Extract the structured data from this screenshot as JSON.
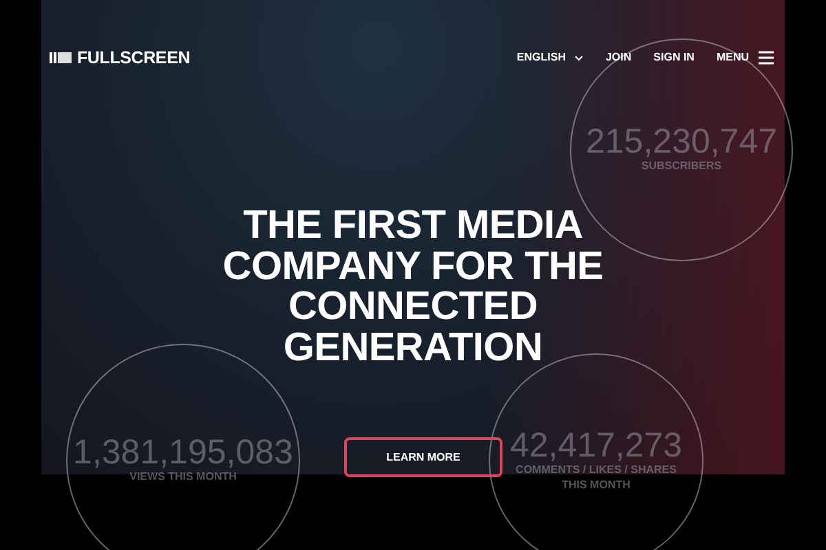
{
  "header": {
    "logo": "FULLSCREEN",
    "nav": [
      {
        "label": "ENGLISH",
        "kind": "dropdown"
      },
      {
        "label": "JOIN",
        "kind": "link"
      },
      {
        "label": "SIGN IN",
        "kind": "link"
      },
      {
        "label": "MENU",
        "kind": "menu"
      }
    ]
  },
  "hero": {
    "headline": "THE FIRST MEDIA COMPANY FOR THE CONNECTED GENERATION",
    "button": "LEARN MORE"
  },
  "stats": [
    {
      "value": "215,230,747",
      "label": "SUBSCRIBERS"
    },
    {
      "value": "1,381,195,083",
      "label": "VIEWS THIS MONTH"
    },
    {
      "value": "42,417,273",
      "label": "COMMENTS / LIKES / SHARES THIS MONTH"
    }
  ]
}
